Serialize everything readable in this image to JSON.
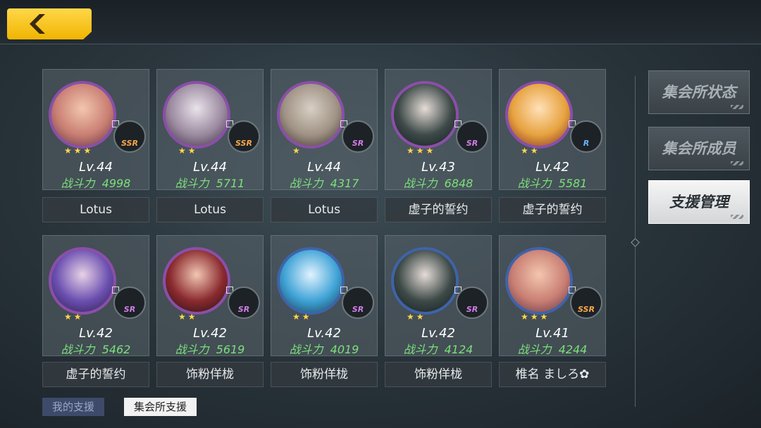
{
  "colors": {
    "accent": "#f0b400",
    "power": "#7be07b",
    "star": "#ffd54a"
  },
  "nav": {
    "back_icon": "chevron-left-icon"
  },
  "side_menu": [
    {
      "label": "集会所状态",
      "active": false
    },
    {
      "label": "集会所成员",
      "active": false
    },
    {
      "label": "支援管理",
      "active": true
    }
  ],
  "power_label": "战斗力",
  "cards": [
    {
      "level": "Lv.44",
      "power": "4998",
      "rarity": "SSR",
      "stars": 3,
      "owner": "Lotus"
    },
    {
      "level": "Lv.44",
      "power": "5711",
      "rarity": "SSR",
      "stars": 2,
      "owner": "Lotus"
    },
    {
      "level": "Lv.44",
      "power": "4317",
      "rarity": "SR",
      "stars": 1,
      "owner": "Lotus"
    },
    {
      "level": "Lv.43",
      "power": "6848",
      "rarity": "SR",
      "stars": 3,
      "owner": "虚子的誓约"
    },
    {
      "level": "Lv.42",
      "power": "5581",
      "rarity": "R",
      "stars": 2,
      "owner": "虚子的誓约"
    },
    {
      "level": "Lv.42",
      "power": "5462",
      "rarity": "SR",
      "stars": 2,
      "owner": "虚子的誓约"
    },
    {
      "level": "Lv.42",
      "power": "5619",
      "rarity": "SR",
      "stars": 2,
      "owner": "饰粉佯栊"
    },
    {
      "level": "Lv.42",
      "power": "4019",
      "rarity": "SR",
      "stars": 2,
      "owner": "饰粉佯栊"
    },
    {
      "level": "Lv.42",
      "power": "4124",
      "rarity": "SR",
      "stars": 2,
      "owner": "饰粉佯栊"
    },
    {
      "level": "Lv.41",
      "power": "4244",
      "rarity": "SSR",
      "stars": 3,
      "owner": "椎名 ましろ✿"
    }
  ],
  "bottom_tabs": [
    {
      "label": "我的支援",
      "active": false
    },
    {
      "label": "集会所支援",
      "active": true
    }
  ]
}
